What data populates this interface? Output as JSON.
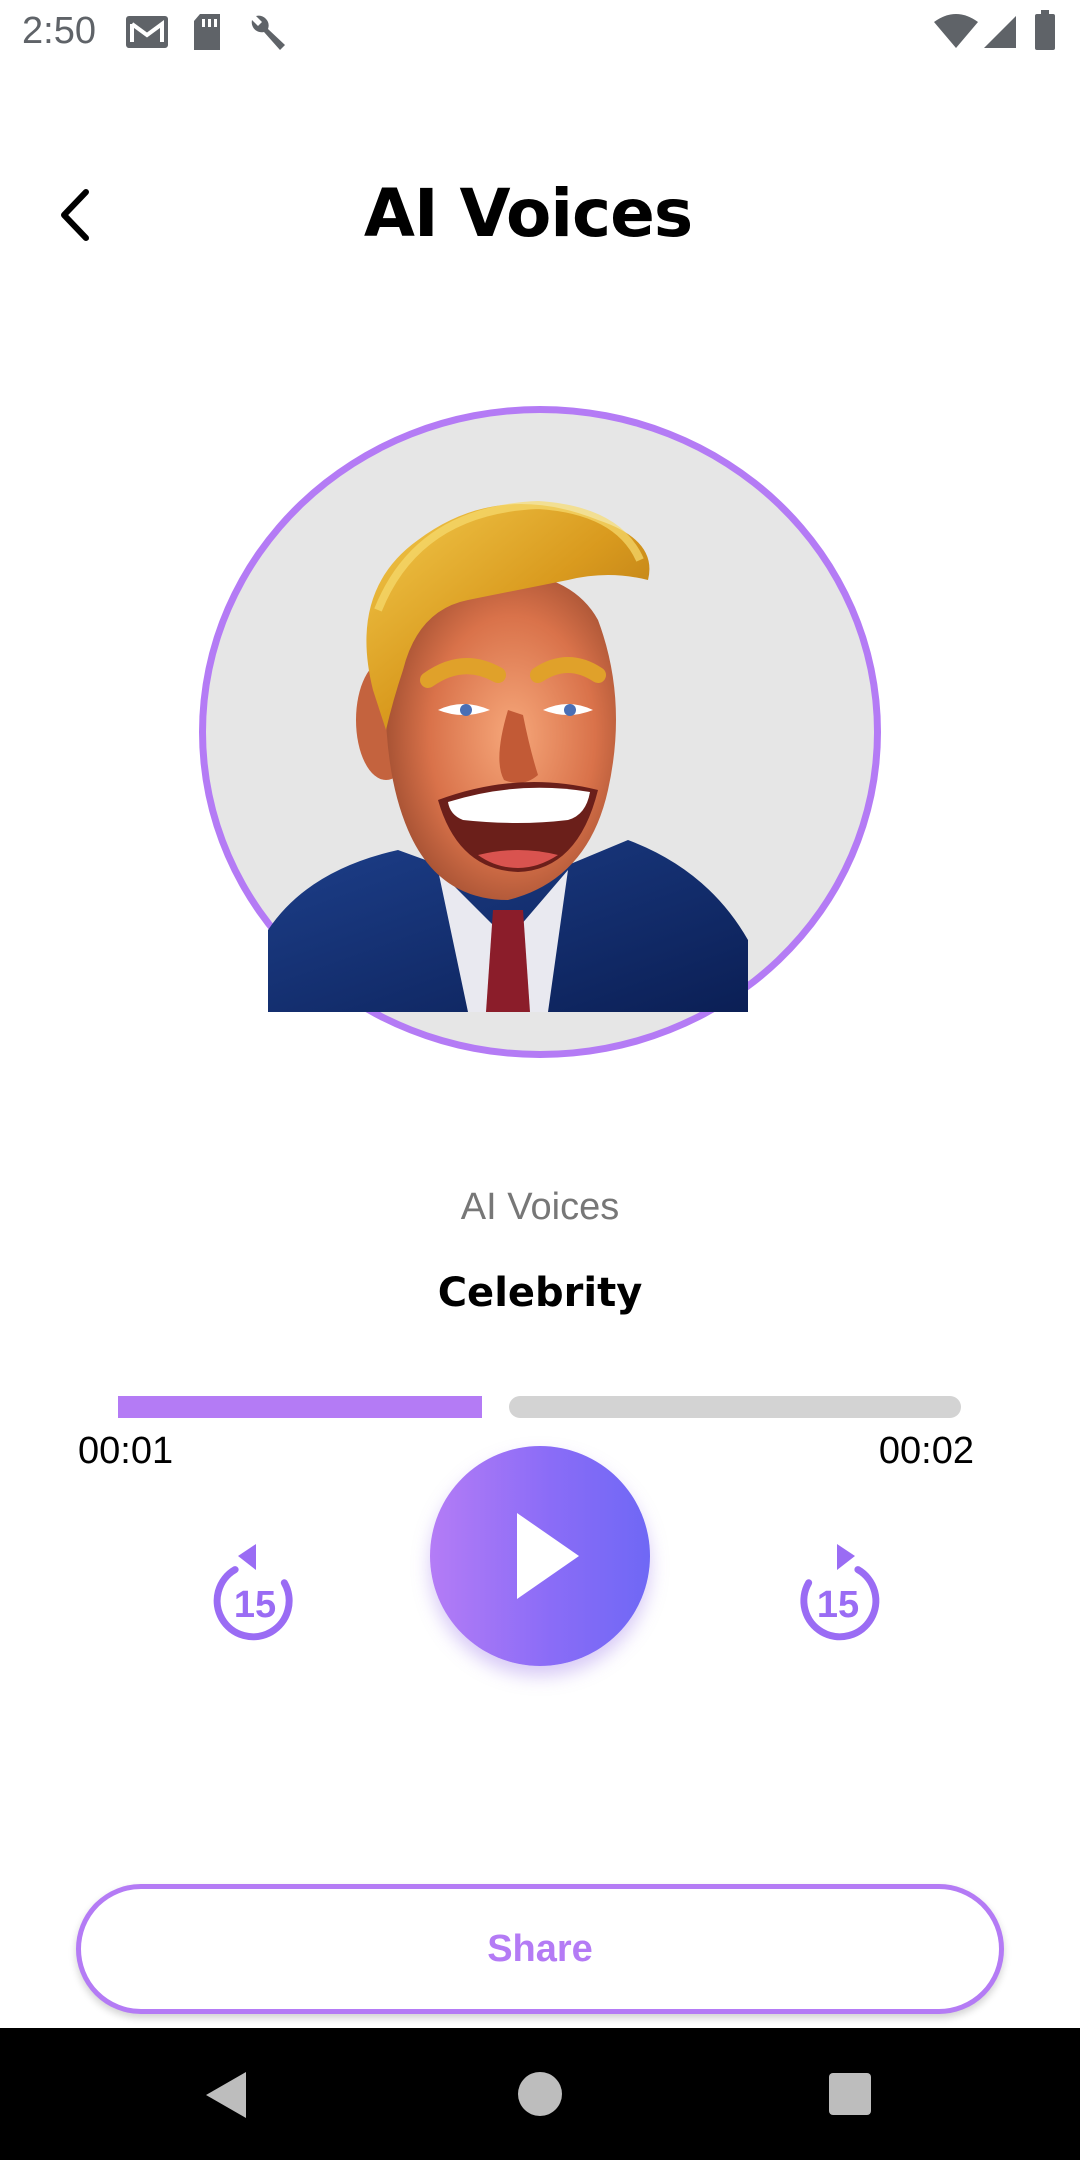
{
  "status_bar": {
    "time": "2:50",
    "icons": [
      "gmail-icon",
      "sd-card-icon",
      "wrench-icon",
      "wifi-icon",
      "cell-signal-icon",
      "battery-icon"
    ]
  },
  "header": {
    "title": "AI Voices",
    "back_icon": "chevron-left-icon"
  },
  "player": {
    "subtitle": "AI Voices",
    "voice_name": "Celebrity",
    "current_time": "00:01",
    "total_time": "00:02",
    "progress_fraction": 0.5,
    "rewind_seconds": "15",
    "forward_seconds": "15"
  },
  "share": {
    "label": "Share"
  },
  "colors": {
    "accent": "#b47bf5",
    "play_gradient_start": "#b47cf6",
    "play_gradient_end": "#6f68f5",
    "track": "#d3d3d3",
    "avatar_bg": "#e6e6e6"
  }
}
